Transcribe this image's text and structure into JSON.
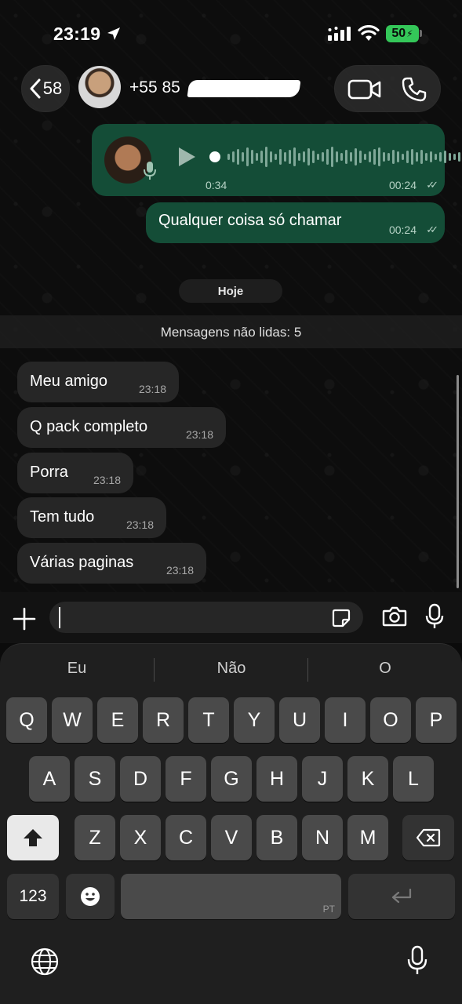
{
  "status_bar": {
    "time": "23:19",
    "battery": "50"
  },
  "header": {
    "back_count": "58",
    "contact_name": "+55 85"
  },
  "messages": {
    "audio": {
      "duration": "0:34",
      "time": "00:24"
    },
    "outgoing_text": {
      "text": "Qualquer coisa só chamar",
      "time": "00:24"
    },
    "date_separator": "Hoje",
    "unread_banner": "Mensagens não lidas: 5",
    "incoming": [
      {
        "text": "Meu amigo",
        "time": "23:18"
      },
      {
        "text": "Q pack completo",
        "time": "23:18"
      },
      {
        "text": "Porra",
        "time": "23:18"
      },
      {
        "text": "Tem tudo",
        "time": "23:18"
      },
      {
        "text": "Várias paginas",
        "time": "23:18"
      }
    ]
  },
  "keyboard": {
    "suggestions": [
      "Eu",
      "Não",
      "O"
    ],
    "row1": [
      "Q",
      "W",
      "E",
      "R",
      "T",
      "Y",
      "U",
      "I",
      "O",
      "P"
    ],
    "row2": [
      "A",
      "S",
      "D",
      "F",
      "G",
      "H",
      "J",
      "K",
      "L"
    ],
    "row3": [
      "Z",
      "X",
      "C",
      "V",
      "B",
      "N",
      "M"
    ],
    "numbers_key": "123",
    "space_language": "PT"
  },
  "colors": {
    "outgoing_bubble": "#144d37",
    "incoming_bubble": "#262626",
    "battery": "#34c759"
  }
}
